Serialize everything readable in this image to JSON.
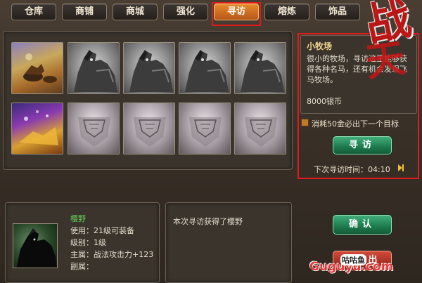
{
  "tabs": [
    {
      "label": "仓库"
    },
    {
      "label": "商铺"
    },
    {
      "label": "商城"
    },
    {
      "label": "强化"
    },
    {
      "label": "寻访"
    },
    {
      "label": "熔炼"
    },
    {
      "label": "饰品"
    }
  ],
  "active_tab": "寻访",
  "grid": {
    "row1": [
      "scene-icon",
      "horse-icon",
      "horse-icon",
      "horse-icon",
      "horse-icon"
    ],
    "row2": [
      "scene-icon",
      "armor-icon",
      "armor-icon",
      "armor-icon",
      "armor-icon"
    ]
  },
  "info": {
    "title": "小牧场",
    "description": "很小的牧场，寻访这里能够获得各种名马，还有机会发现飞马牧场。",
    "cost": "8000银币"
  },
  "checkbox_label": "消耗50金必出下一个目标",
  "seek_button": "寻访",
  "timer_label": "下次寻访时间：04:10",
  "item": {
    "name": "樱野",
    "use": "使用：21级可装备",
    "level": "级别：1级",
    "main": "主属：战法攻击力+123",
    "sub": "副属："
  },
  "result_text": "本次寻访获得了樱野",
  "confirm_button": "确认",
  "red_button": "再寻出",
  "logo_text": "战",
  "logo_text2": "天",
  "watermark": "Guguyu.com",
  "watermark_cn": "咕咕鱼",
  "colors": {
    "accent_orange": "#d06a22",
    "highlight_red": "#e01a1a",
    "button_green": "#1d7a4c",
    "item_name_green": "#66cc55",
    "title_gold": "#f3d590"
  }
}
